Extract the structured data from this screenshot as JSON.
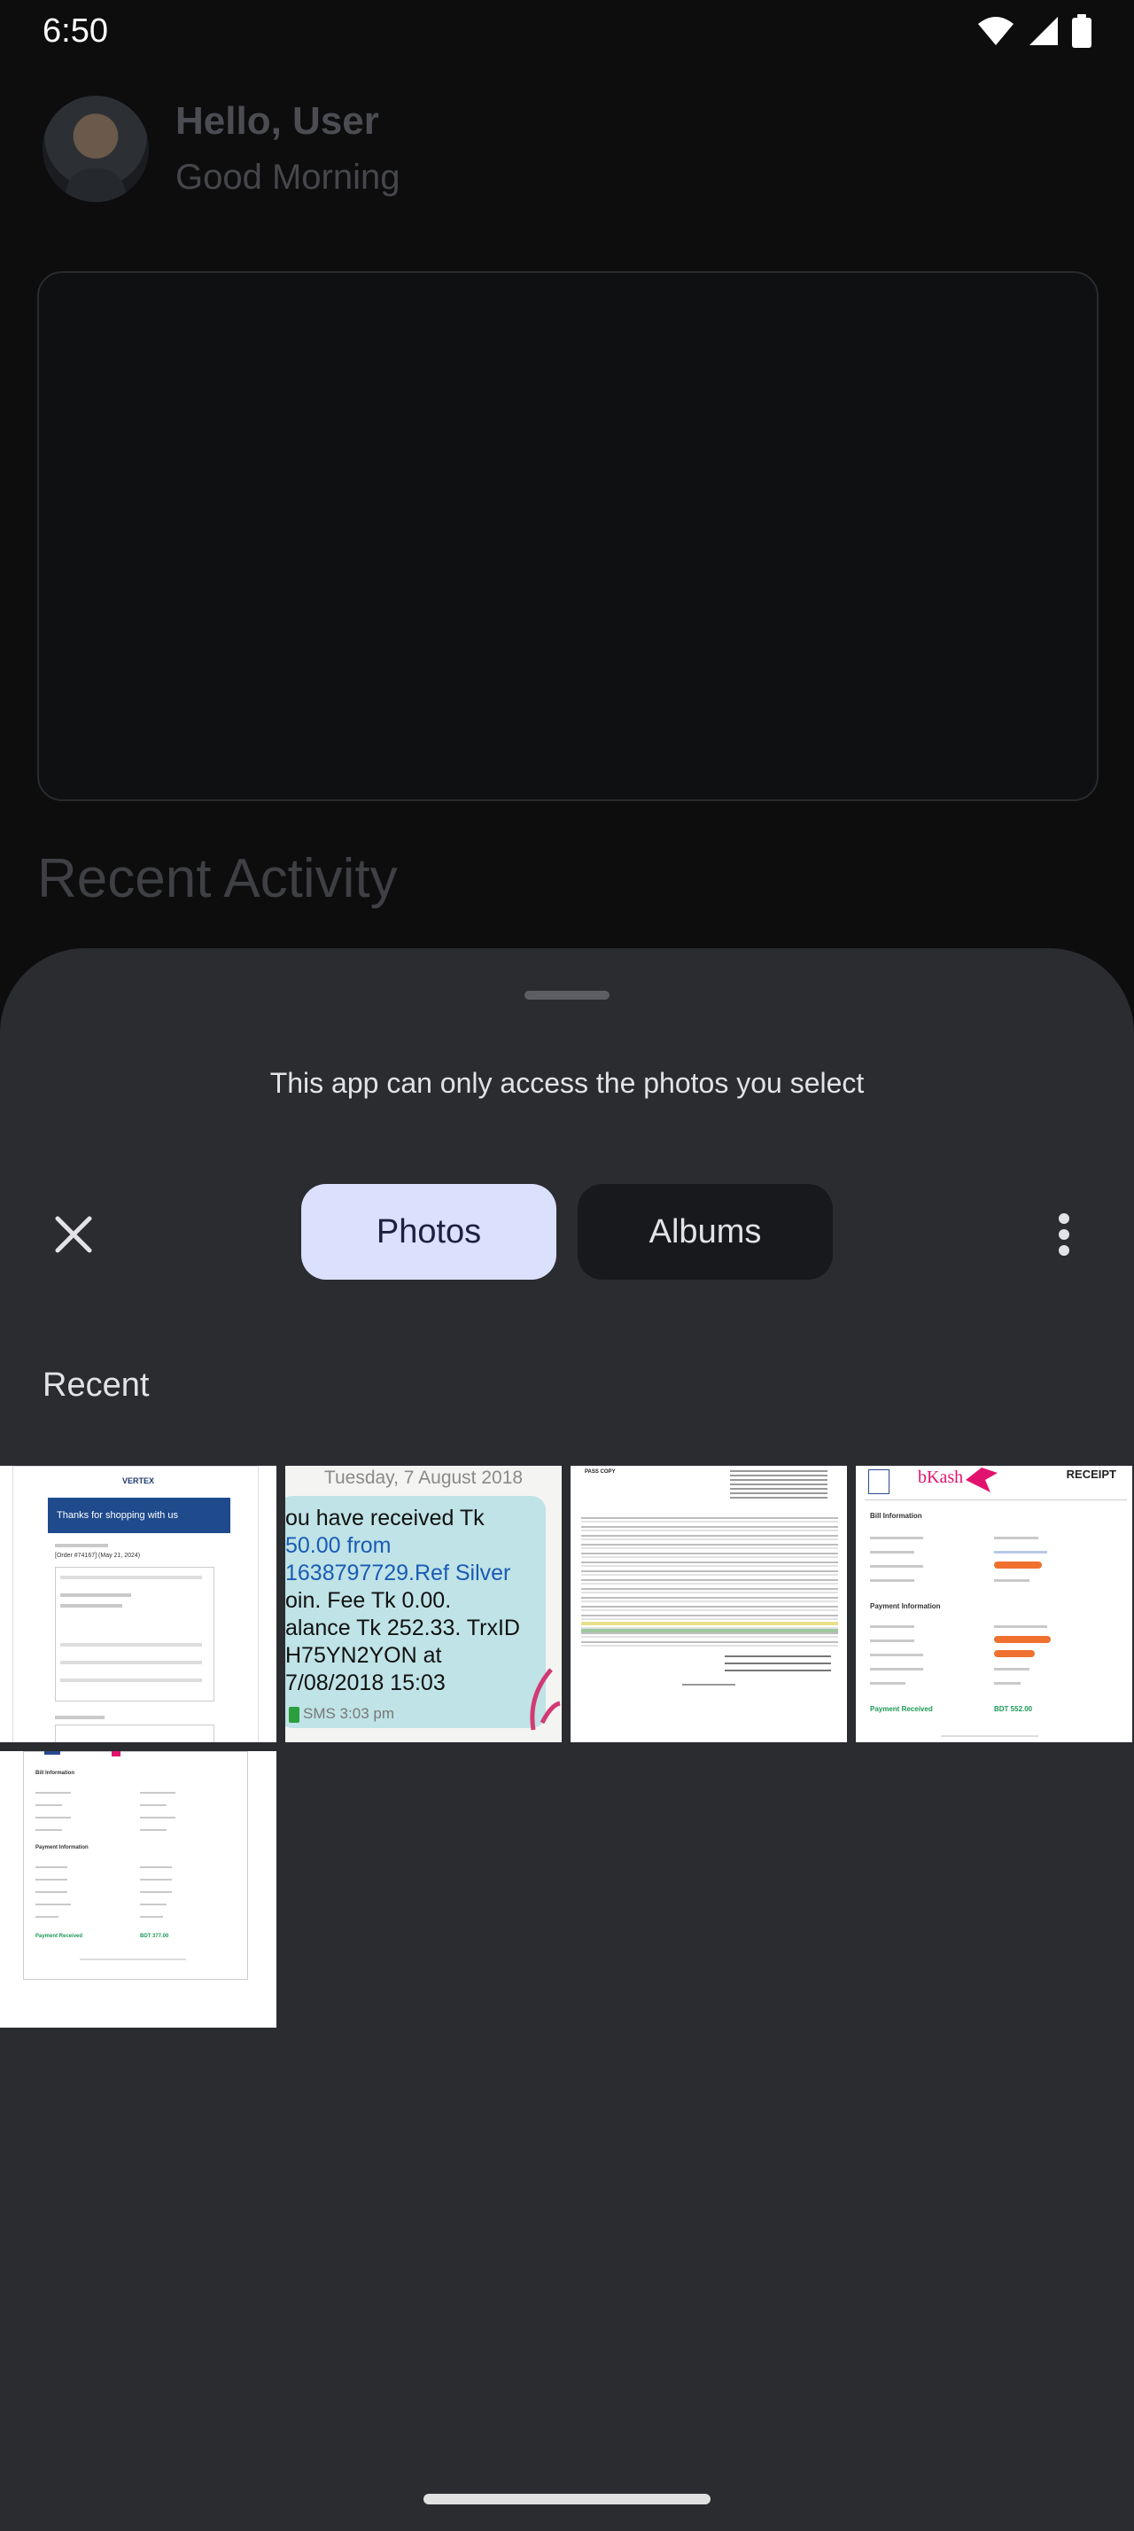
{
  "status_bar": {
    "time": "6:50"
  },
  "background_app": {
    "greeting": "Hello, User",
    "subgreeting": "Good Morning",
    "section_title": "Recent Activity"
  },
  "picker": {
    "access_notice": "This app can only access the photos you select",
    "tabs": [
      {
        "label": "Photos",
        "selected": true
      },
      {
        "label": "Albums",
        "selected": false
      }
    ],
    "section_label": "Recent",
    "photos": [
      {
        "id": "vertex-order",
        "brand": "VERTEX",
        "banner": "Thanks for shopping with us",
        "order": "[Order #74167] (May 21, 2024)"
      },
      {
        "id": "sms-receipt",
        "date": "Tuesday, 7 August 2018",
        "lines": [
          "ou have received Tk",
          "50.00 from",
          "1638797729.Ref Silver",
          "oin. Fee Tk 0.00.",
          "alance Tk 252.33. TrxID",
          "H75YN2YON at",
          "7/08/2018 15:03"
        ],
        "footer": "SMS 3:03 pm"
      },
      {
        "id": "bank-statement",
        "heading": "PASS COPY"
      },
      {
        "id": "bkash-receipt",
        "brand": "bKash",
        "title": "RECEIPT",
        "section1": "Bill Information",
        "section2": "Payment Information",
        "received": "Payment Received",
        "amount": "BDT 552.00"
      },
      {
        "id": "bill-receipt",
        "section1": "Bill Information",
        "section2": "Payment Information",
        "received": "Payment Received",
        "amount": "BDT 377.00"
      }
    ]
  },
  "colors": {
    "sheet_bg": "#2b2c30",
    "tab_selected_bg": "#dbe0fd",
    "tab_unselected_bg": "#18191c",
    "bkash_pink": "#e2136e"
  }
}
